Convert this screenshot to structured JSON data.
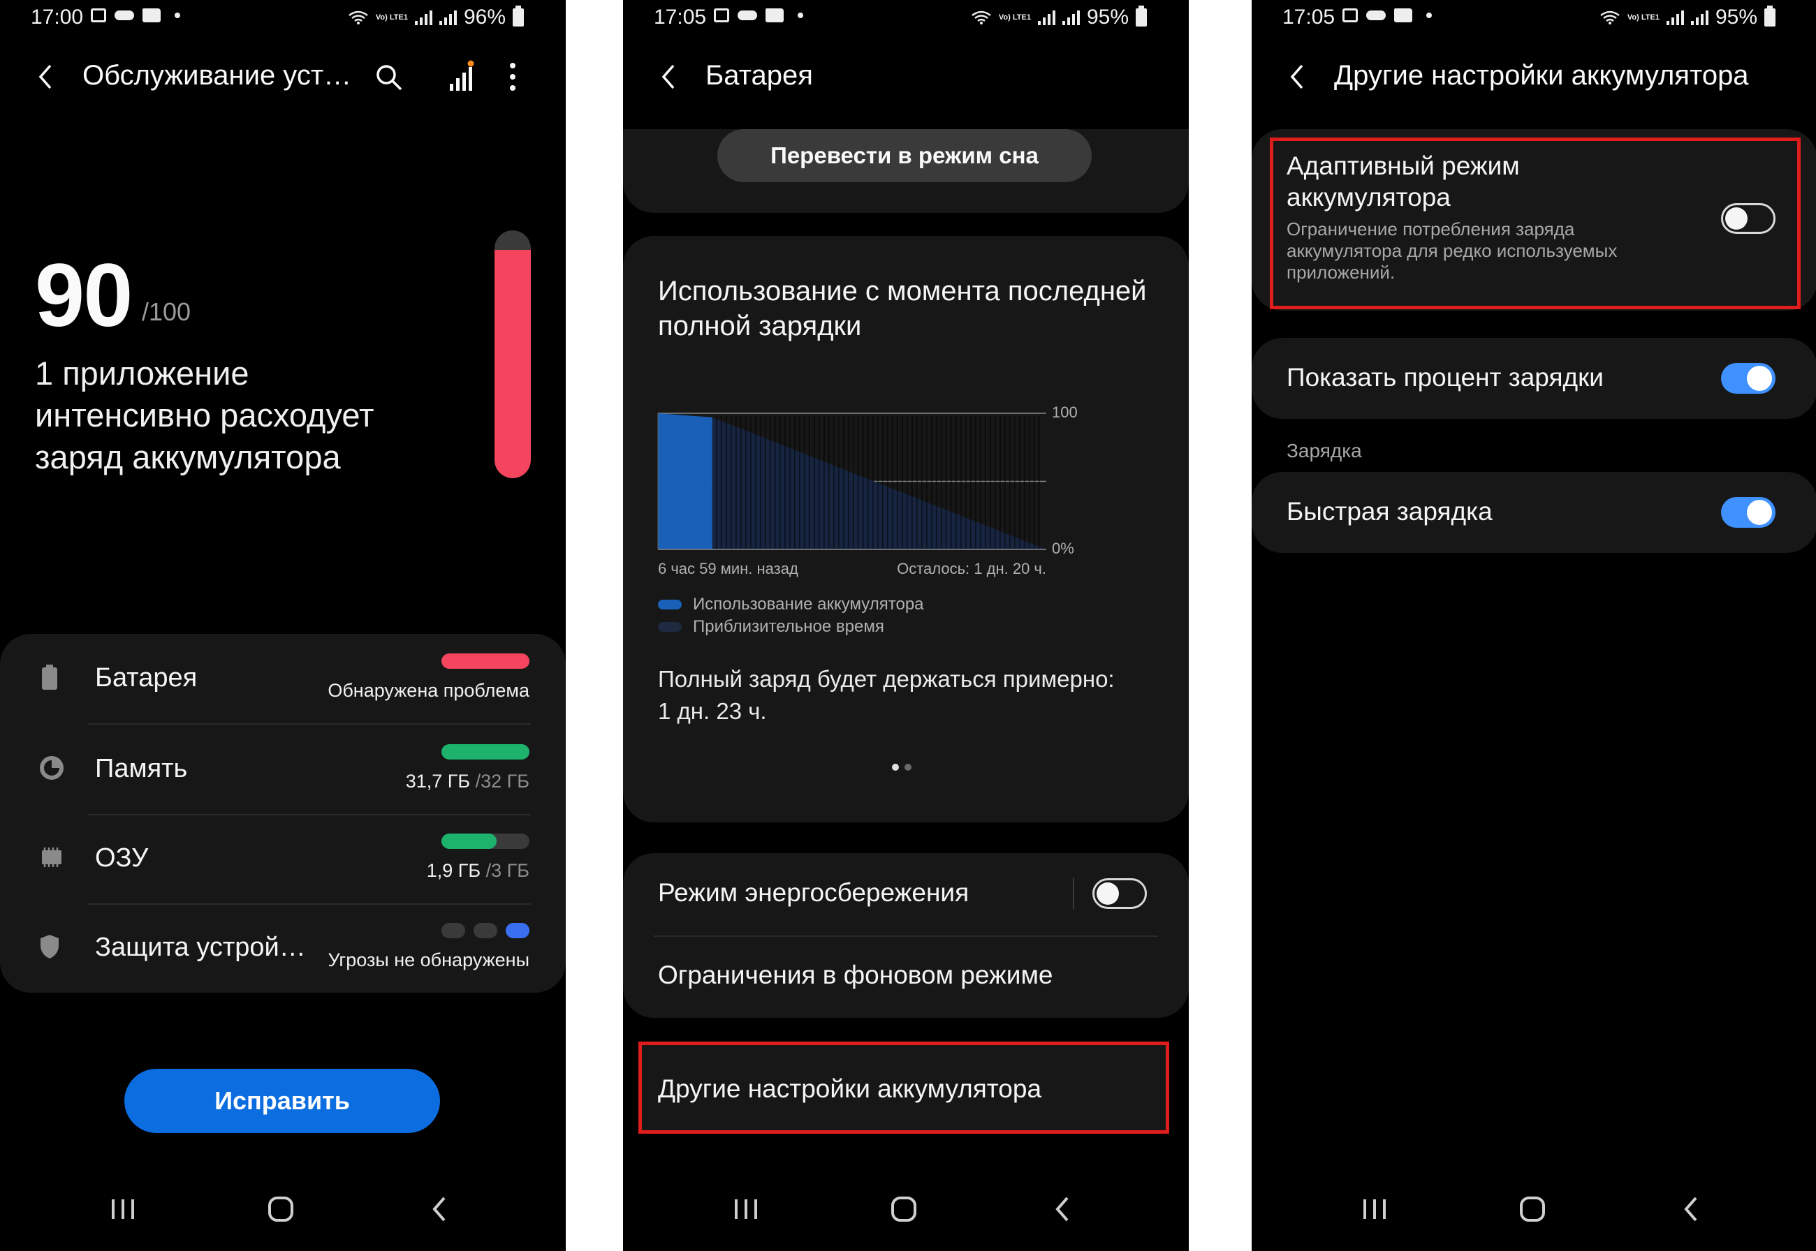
{
  "screens": {
    "device_care": {
      "status": {
        "time": "17:00",
        "battery": "96%",
        "volte": "Vo) LTE1"
      },
      "header": {
        "title": "Обслуживание уст…",
        "icons": [
          "back-arrow-icon",
          "search-icon",
          "stats-icon",
          "more-vert-icon"
        ]
      },
      "score": {
        "value": "90",
        "max": "/100",
        "gauge_fraction": 0.92,
        "gauge_color": "#f5455e"
      },
      "message": "1 приложение интенсивно расходует заряд аккумулятора",
      "items": [
        {
          "label": "Батарея",
          "sub": "Обнаружена проблема",
          "sub_dim": "",
          "bar_fraction": 1.0,
          "bar_color": "#f5455e",
          "icon": "battery-icon"
        },
        {
          "label": "Память",
          "sub": "31,7 ГБ",
          "sub_dim": " /32 ГБ",
          "bar_fraction": 1.0,
          "bar_color": "#1db36d",
          "icon": "storage-pie-icon"
        },
        {
          "label": "ОЗУ",
          "sub": "1,9 ГБ",
          "sub_dim": " /3 ГБ",
          "bar_fraction": 0.63,
          "bar_color": "#1db36d",
          "icon": "memory-chip-icon"
        },
        {
          "label": "Защита устрой…",
          "sub": "Угрозы не обнаружены",
          "sub_dim": "",
          "icon": "shield-icon",
          "dot_colors": [
            "#3a3a3a",
            "#3a3a3a",
            "#3a6ff0"
          ]
        }
      ],
      "fix_button": "Исправить"
    },
    "battery": {
      "status": {
        "time": "17:05",
        "battery": "95%",
        "volte": "Vo) LTE1"
      },
      "header": {
        "title": "Батарея"
      },
      "sleep_button": "Перевести в режим сна",
      "usage": {
        "title": "Использование с момента последней полной зарядки",
        "legend": [
          {
            "label": "Использование аккумулятора",
            "color": "#1a5fb8"
          },
          {
            "label": "Приблизительное время",
            "color": "#1e2a40"
          }
        ],
        "full_charge_text": "Полный заряд будет держаться примерно:",
        "full_charge_value": "1 дн. 23 ч."
      },
      "chart_data": {
        "type": "area",
        "title": "",
        "y_tick_labels": [
          "100",
          "0%"
        ],
        "ylim": [
          0,
          100
        ],
        "x_start_label": "6 час 59 мин. назад",
        "x_end_label": "Осталось: 1 дн. 20 ч.",
        "series": [
          {
            "name": "Использование аккумулятора",
            "x": [
              0,
              0.14
            ],
            "values": [
              100,
              97
            ]
          },
          {
            "name": "Приблизительное время",
            "x": [
              0.14,
              1.0
            ],
            "values": [
              97,
              0
            ]
          }
        ]
      },
      "options": {
        "power_saving": "Режим энергосбережения",
        "power_saving_on": false,
        "background_limits": "Ограничения в фоновом режиме",
        "more_settings": "Другие настройки аккумулятора"
      }
    },
    "more_battery_settings": {
      "status": {
        "time": "17:05",
        "battery": "95%",
        "volte": "Vo) LTE1"
      },
      "header": {
        "title": "Другие настройки аккумулятора"
      },
      "adaptive": {
        "title": "Адаптивный режим аккумулятора",
        "desc": "Ограничение потребления заряда аккумулятора для редко используемых приложений.",
        "on": false
      },
      "show_percent": {
        "label": "Показать процент зарядки",
        "on": true
      },
      "charging_header": "Зарядка",
      "fast_charge": {
        "label": "Быстрая зарядка",
        "on": true
      }
    }
  },
  "colors": {
    "background": "#000000",
    "card": "#171717",
    "accent_blue": "#3e91ff",
    "highlight_red": "#e01d1d"
  }
}
